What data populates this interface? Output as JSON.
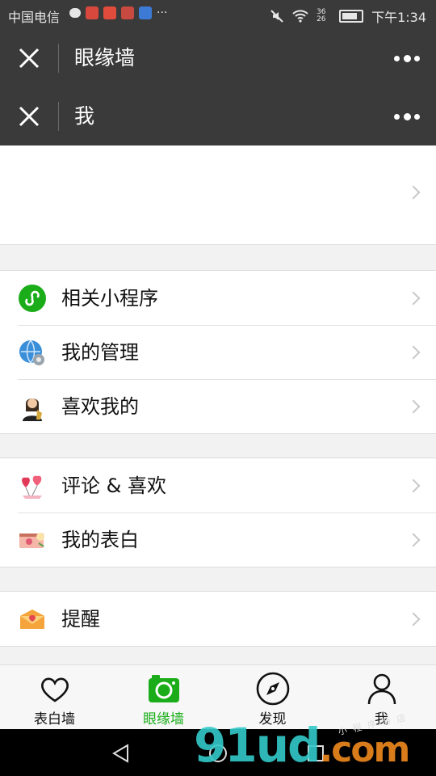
{
  "status_bar": {
    "carrier": "中国电信",
    "time": "下午1:34",
    "network": "36 26",
    "icons": [
      "heart-monitor-icon",
      "weibo-icon",
      "map-pin-icon",
      "game-icon",
      "book-icon",
      "more-dots-icon",
      "mute-icon",
      "wifi-icon",
      "signal-icon",
      "battery-icon"
    ]
  },
  "navbars": [
    {
      "title": "眼缘墙"
    },
    {
      "title": "我"
    }
  ],
  "menu_groups": [
    {
      "items": [
        {
          "label": "相关小程序",
          "icon": "mini-program-icon"
        },
        {
          "label": "我的管理",
          "icon": "globe-gear-icon"
        },
        {
          "label": "喜欢我的",
          "icon": "avatar-icon"
        }
      ]
    },
    {
      "items": [
        {
          "label": "评论 & 喜欢",
          "icon": "heart-balloons-icon"
        },
        {
          "label": "我的表白",
          "icon": "love-letter-icon"
        }
      ]
    },
    {
      "items": [
        {
          "label": "提醒",
          "icon": "envelope-icon"
        }
      ]
    }
  ],
  "tabs": [
    {
      "label": "表白墙",
      "icon": "heart-outline-icon"
    },
    {
      "label": "眼缘墙",
      "icon": "camera-icon",
      "active": true
    },
    {
      "label": "发现",
      "icon": "compass-icon"
    },
    {
      "label": "我",
      "icon": "person-icon"
    }
  ],
  "colors": {
    "accent": "#1aad19",
    "header": "#3a3a3a",
    "background": "#f2f2f2"
  },
  "watermark": {
    "text": "91ud",
    "suffix": ".com",
    "small_text": "小 程 序 商 店"
  }
}
